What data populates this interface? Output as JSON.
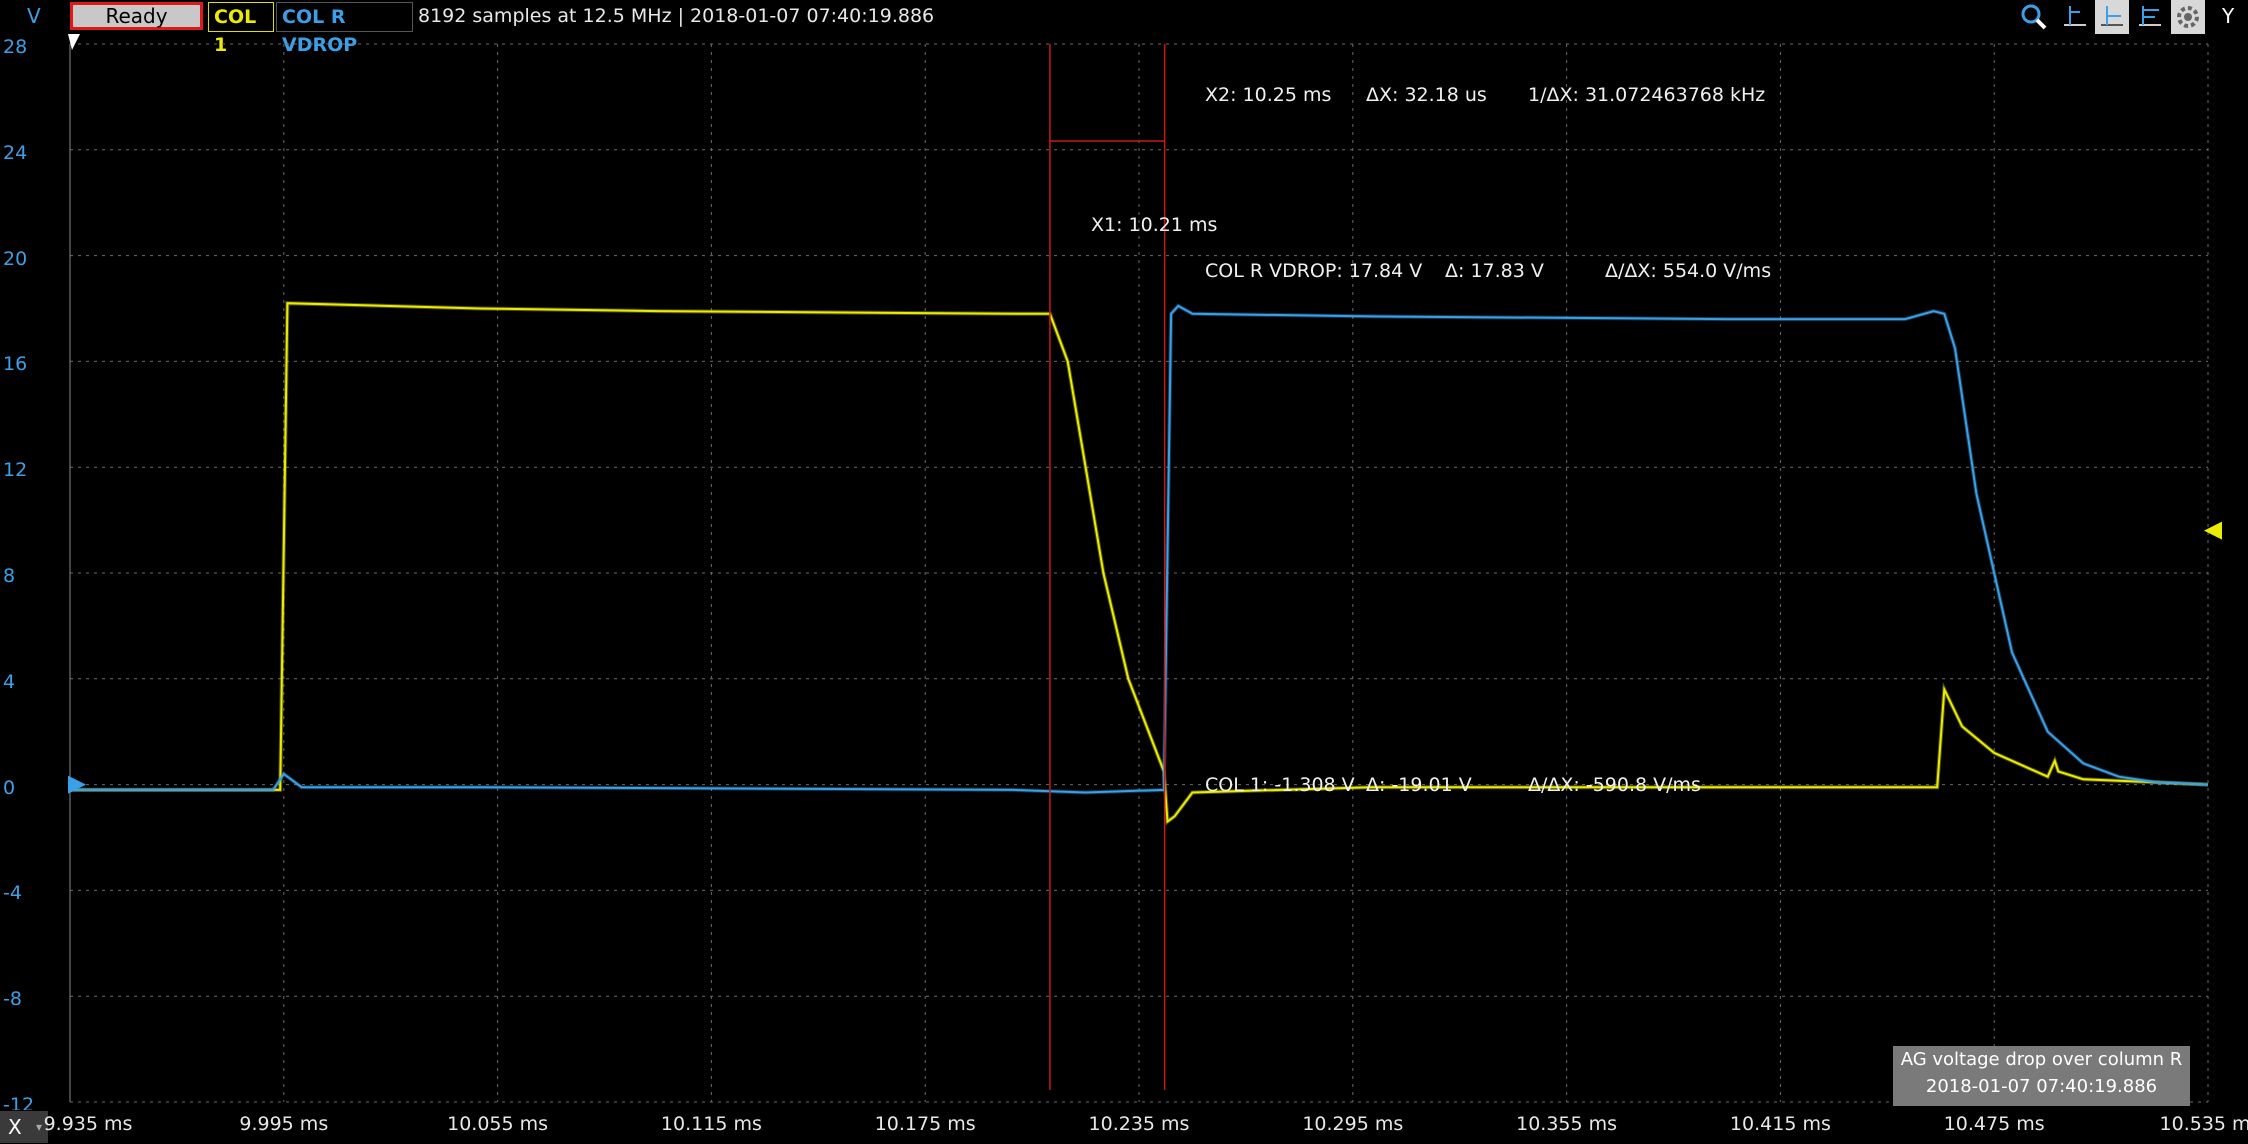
{
  "toolbar": {
    "y_unit": "V",
    "status": "Ready",
    "channels": [
      {
        "label": "COL 1",
        "color": "#ecec00"
      },
      {
        "label": "COL R VDROP",
        "color": "#3aa0e8"
      }
    ],
    "acquisition_info": "8192 samples at 12.5 MHz | 2018-01-07 07:40:19.886",
    "icons": [
      "zoom-icon",
      "cursor-x-icon",
      "cursor-y-icon",
      "cursor-xy-icon",
      "settings-icon"
    ],
    "y_button": "Y"
  },
  "x_axis": {
    "button": "X",
    "ticks": [
      "9.935 ms",
      "9.995 ms",
      "10.055 ms",
      "10.115 ms",
      "10.175 ms",
      "10.235 ms",
      "10.295 ms",
      "10.355 ms",
      "10.415 ms",
      "10.475 ms",
      "10.535 ms"
    ]
  },
  "y_axis": {
    "ticks": [
      "28",
      "24",
      "20",
      "16",
      "12",
      "8",
      "4",
      "0",
      "-4",
      "-8",
      "-12"
    ]
  },
  "cursors": {
    "x1": "X1: 10.21 ms",
    "x2": "X2: 10.25 ms",
    "dx": "ΔX: 32.18 us",
    "inv_dx": "1/ΔX: 31.072463768 kHz",
    "col_r": {
      "value": "COL R VDROP: 17.84 V",
      "delta": "Δ: 17.83 V",
      "slope": "Δ/ΔX: 554.0 V/ms"
    },
    "col_1": {
      "value": "COL 1: -1.308 V",
      "delta": "Δ: -19.01 V",
      "slope": "Δ/ΔX: -590.8 V/ms"
    }
  },
  "note": {
    "title": "AG voltage drop over column R",
    "timestamp": "2018-01-07 07:40:19.886"
  },
  "colors": {
    "ch1": "#ecec00",
    "ch2": "#3aa0e8",
    "cursor": "#c81818",
    "grid": "#6a6a6a"
  },
  "chart_data": {
    "type": "line",
    "xlabel": "",
    "ylabel": "V",
    "xlim": [
      9.935,
      10.535
    ],
    "ylim": [
      -12,
      28
    ],
    "grid": true,
    "series": [
      {
        "name": "COL 1",
        "x": [
          9.935,
          9.99,
          9.994,
          9.996,
          10.05,
          10.1,
          10.2,
          10.21,
          10.215,
          10.22,
          10.225,
          10.232,
          10.242,
          10.243,
          10.245,
          10.25,
          10.3,
          10.4,
          10.459,
          10.461,
          10.466,
          10.475,
          10.49,
          10.492,
          10.493,
          10.5,
          10.535
        ],
        "values": [
          -0.2,
          -0.2,
          -0.2,
          18.2,
          18.0,
          17.9,
          17.8,
          17.8,
          16.0,
          12.0,
          8.0,
          4.0,
          0.5,
          -1.4,
          -1.2,
          -0.3,
          -0.1,
          -0.1,
          -0.1,
          3.6,
          2.2,
          1.2,
          0.3,
          0.9,
          0.5,
          0.2,
          0.0
        ]
      },
      {
        "name": "COL R VDROP",
        "x": [
          9.935,
          9.992,
          9.995,
          10.0,
          10.05,
          10.2,
          10.22,
          10.242,
          10.244,
          10.246,
          10.25,
          10.3,
          10.4,
          10.45,
          10.458,
          10.461,
          10.464,
          10.47,
          10.48,
          10.49,
          10.5,
          10.51,
          10.52,
          10.535
        ],
        "values": [
          -0.2,
          -0.2,
          0.4,
          -0.1,
          -0.1,
          -0.2,
          -0.3,
          -0.2,
          17.8,
          18.1,
          17.8,
          17.7,
          17.6,
          17.6,
          17.9,
          17.8,
          16.5,
          11.0,
          5.0,
          2.0,
          0.8,
          0.3,
          0.1,
          0.0
        ]
      }
    ]
  }
}
